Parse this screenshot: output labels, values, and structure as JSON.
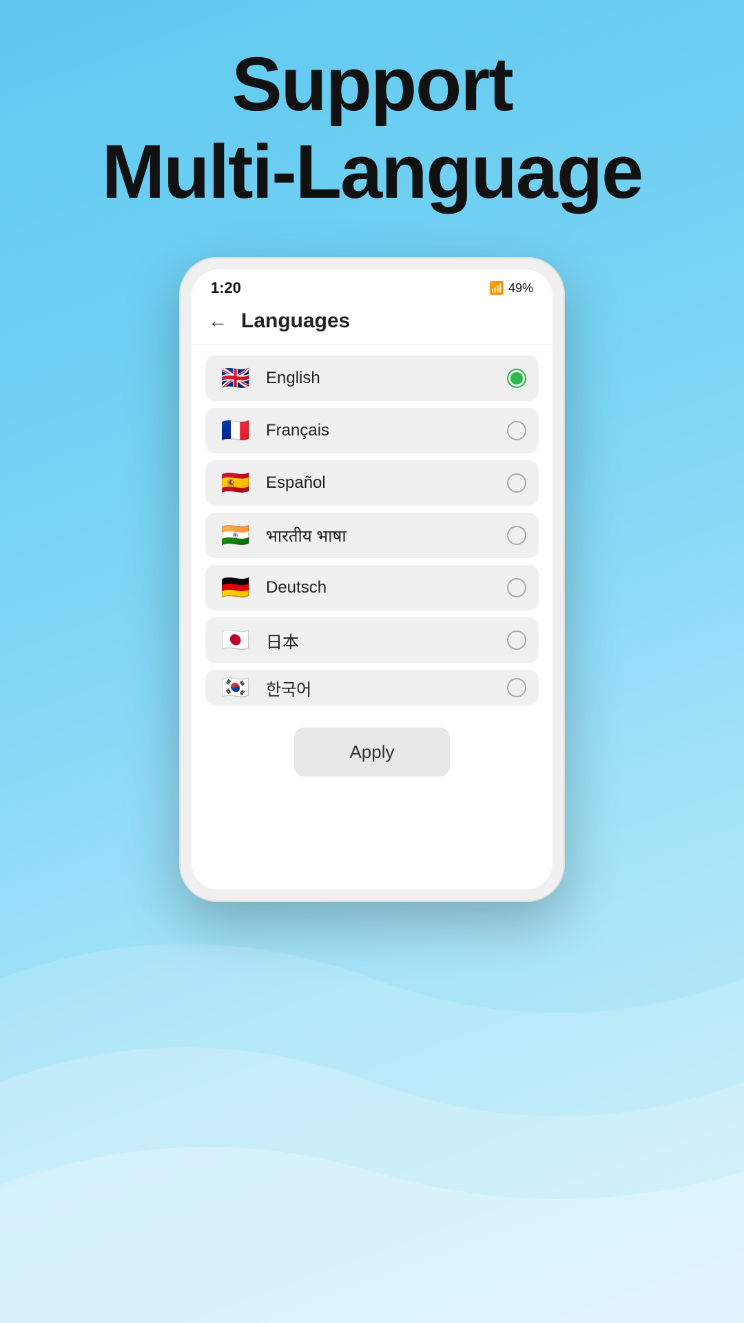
{
  "header": {
    "line1": "Support",
    "line2": "Multi-Language"
  },
  "status_bar": {
    "time": "1:20",
    "battery": "49%"
  },
  "app": {
    "back_label": "←",
    "title": "Languages"
  },
  "languages": [
    {
      "id": "english",
      "name": "English",
      "flag_emoji": "🇬🇧",
      "selected": true
    },
    {
      "id": "french",
      "name": "Français",
      "flag_emoji": "🇫🇷",
      "selected": false
    },
    {
      "id": "spanish",
      "name": "Español",
      "flag_emoji": "🇪🇸",
      "selected": false
    },
    {
      "id": "hindi",
      "name": "भारतीय भाषा",
      "flag_emoji": "🇮🇳",
      "selected": false
    },
    {
      "id": "german",
      "name": "Deutsch",
      "flag_emoji": "🇩🇪",
      "selected": false
    },
    {
      "id": "japanese",
      "name": "日本",
      "flag_emoji": "🇯🇵",
      "selected": false
    },
    {
      "id": "korean",
      "name": "한국어",
      "flag_emoji": "🇰🇷",
      "selected": false
    }
  ],
  "apply_button": {
    "label": "Apply"
  },
  "colors": {
    "selected_green": "#2db84b",
    "background_sky": "#5ec8f0"
  }
}
